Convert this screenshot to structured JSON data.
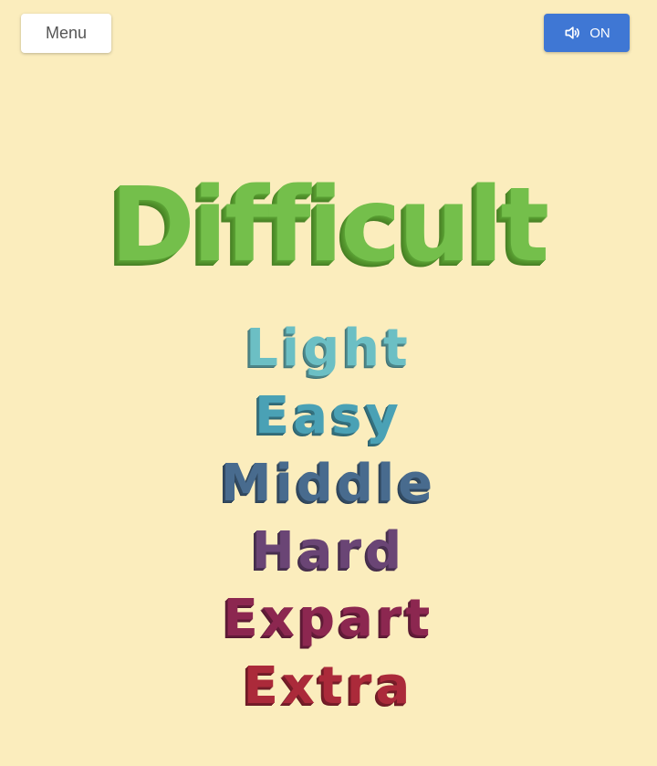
{
  "header": {
    "menu_label": "Menu",
    "sound_label": "ON",
    "sound_icon": "speaker-icon"
  },
  "title": {
    "text": "Difficult",
    "color": "#74bf4b"
  },
  "levels": [
    {
      "label": "Light",
      "color": "#6cbfc4"
    },
    {
      "label": "Easy",
      "color": "#4aa1b5"
    },
    {
      "label": "Middle",
      "color": "#486b8e"
    },
    {
      "label": "Hard",
      "color": "#6a4575"
    },
    {
      "label": "Expart",
      "color": "#8c2750"
    },
    {
      "label": "Extra",
      "color": "#ab2a3a"
    }
  ]
}
